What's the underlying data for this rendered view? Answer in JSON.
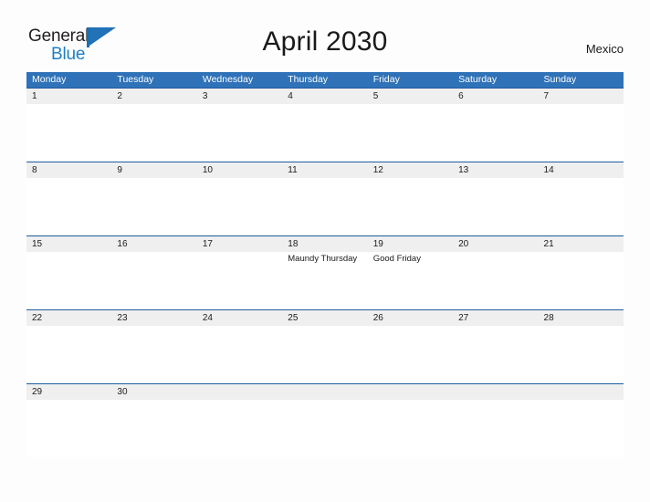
{
  "brand": {
    "name_part1": "General",
    "name_part2": "Blue",
    "flag_icon": "flag-icon",
    "accent_color": "#1f7fc4"
  },
  "header": {
    "title": "April 2030",
    "country": "Mexico"
  },
  "theme": {
    "header_blue": "#2f72b8",
    "divider_blue": "#1f5c9e",
    "band_gray": "#efefef",
    "page_background": "#fdfdfd",
    "text_color": "#1b1b1b"
  },
  "calendar": {
    "month": "April",
    "year": "2030",
    "weekday_headers": [
      "Monday",
      "Tuesday",
      "Wednesday",
      "Thursday",
      "Friday",
      "Saturday",
      "Sunday"
    ],
    "weeks": [
      {
        "days": [
          {
            "date": "1",
            "events": []
          },
          {
            "date": "2",
            "events": []
          },
          {
            "date": "3",
            "events": []
          },
          {
            "date": "4",
            "events": []
          },
          {
            "date": "5",
            "events": []
          },
          {
            "date": "6",
            "events": []
          },
          {
            "date": "7",
            "events": []
          }
        ]
      },
      {
        "days": [
          {
            "date": "8",
            "events": []
          },
          {
            "date": "9",
            "events": []
          },
          {
            "date": "10",
            "events": []
          },
          {
            "date": "11",
            "events": []
          },
          {
            "date": "12",
            "events": []
          },
          {
            "date": "13",
            "events": []
          },
          {
            "date": "14",
            "events": []
          }
        ]
      },
      {
        "days": [
          {
            "date": "15",
            "events": []
          },
          {
            "date": "16",
            "events": []
          },
          {
            "date": "17",
            "events": []
          },
          {
            "date": "18",
            "events": [
              "Maundy Thursday"
            ]
          },
          {
            "date": "19",
            "events": [
              "Good Friday"
            ]
          },
          {
            "date": "20",
            "events": []
          },
          {
            "date": "21",
            "events": []
          }
        ]
      },
      {
        "days": [
          {
            "date": "22",
            "events": []
          },
          {
            "date": "23",
            "events": []
          },
          {
            "date": "24",
            "events": []
          },
          {
            "date": "25",
            "events": []
          },
          {
            "date": "26",
            "events": []
          },
          {
            "date": "27",
            "events": []
          },
          {
            "date": "28",
            "events": []
          }
        ]
      },
      {
        "days": [
          {
            "date": "29",
            "events": []
          },
          {
            "date": "30",
            "events": []
          },
          {
            "date": "",
            "events": []
          },
          {
            "date": "",
            "events": []
          },
          {
            "date": "",
            "events": []
          },
          {
            "date": "",
            "events": []
          },
          {
            "date": "",
            "events": []
          }
        ]
      }
    ]
  }
}
